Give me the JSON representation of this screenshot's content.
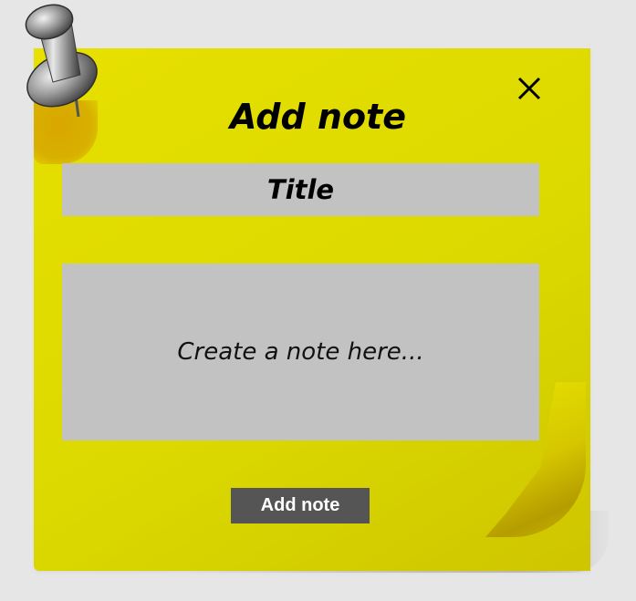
{
  "dialog": {
    "title": "Add note",
    "close_icon": "close-icon",
    "title_field": {
      "placeholder": "Title",
      "value": ""
    },
    "body_field": {
      "placeholder": "Create a note here...",
      "value": ""
    },
    "submit_label": "Add note",
    "pin_icon": "push-pin-icon"
  },
  "colors": {
    "note": "#dcd900",
    "fields": "#c2c2c2",
    "button": "#555555",
    "background": "#e6e6e6"
  }
}
